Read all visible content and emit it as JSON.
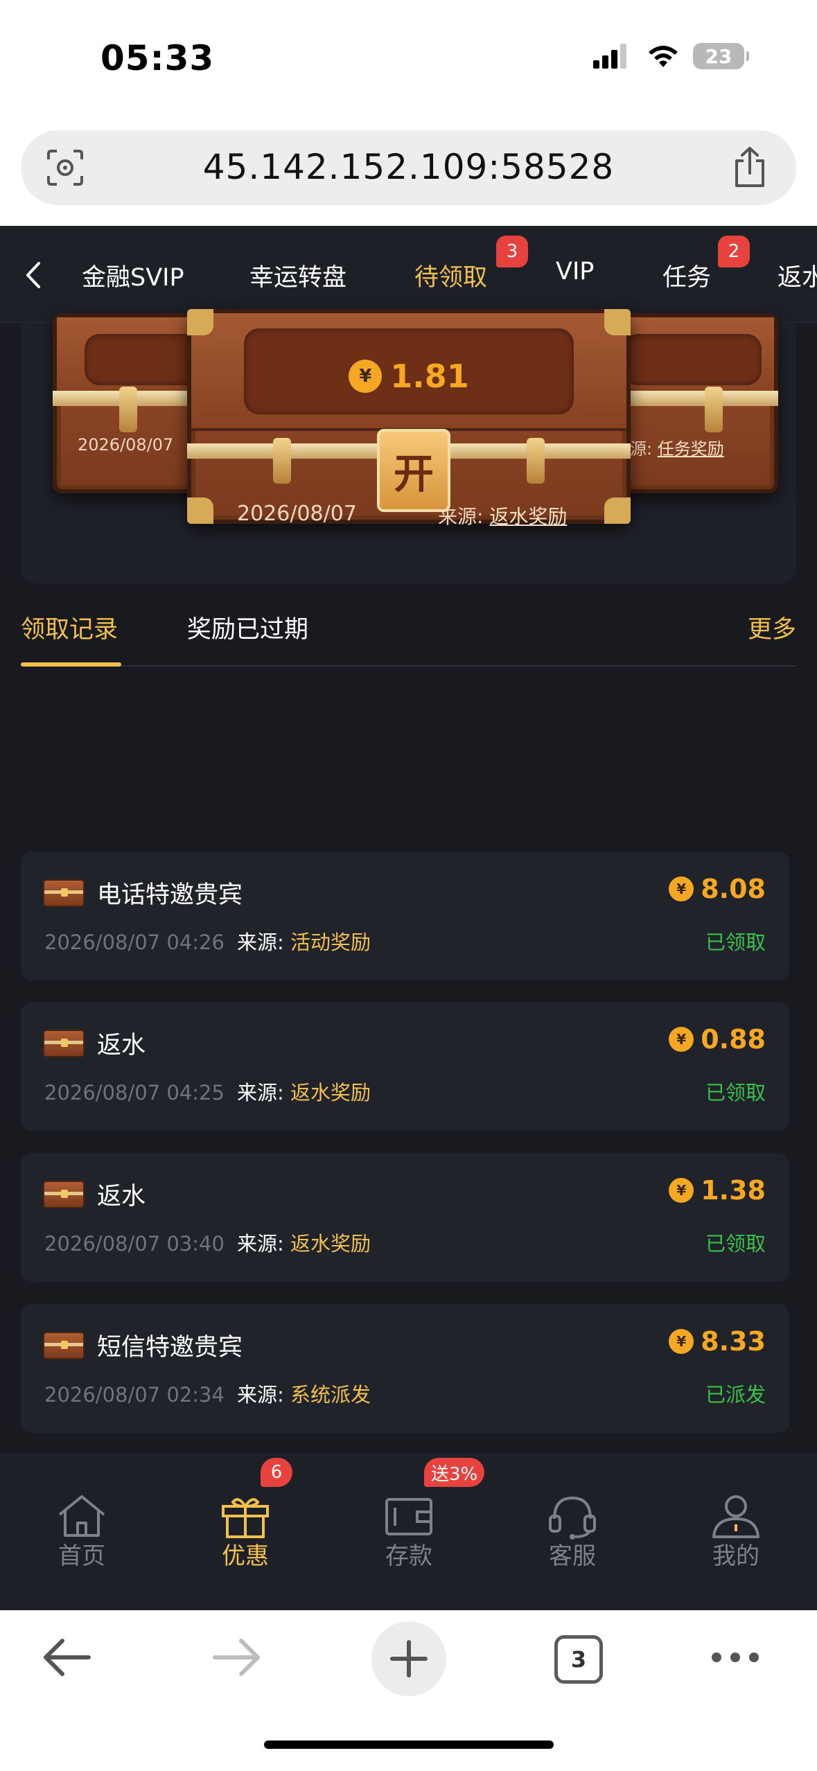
{
  "status_bar": {
    "time": "05:33",
    "battery": "23"
  },
  "browser": {
    "url": "45.142.152.109:58528",
    "tab_count": "3"
  },
  "top_tabs": [
    {
      "label": "金融SVIP"
    },
    {
      "label": "幸运转盘"
    },
    {
      "label": "待领取",
      "badge": "3",
      "active": true
    },
    {
      "label": "VIP"
    },
    {
      "label": "任务",
      "badge": "2"
    },
    {
      "label": "返水"
    }
  ],
  "chests": {
    "left": {
      "date": "2026/08/07"
    },
    "center": {
      "amount": "1.81",
      "lock_label": "开",
      "date": "2026/08/07",
      "source_label": "来源:",
      "source_value": "返水奖励"
    },
    "right": {
      "source_label": "源:",
      "source_value": "任务奖励"
    },
    "currency_symbol": "¥"
  },
  "records": {
    "tabs": [
      {
        "label": "领取记录",
        "active": true
      },
      {
        "label": "奖励已过期"
      }
    ],
    "more_label": "更多",
    "source_label": "来源:",
    "items": [
      {
        "title": "电话特邀贵宾",
        "datetime": "2026/08/07 04:26",
        "source": "活动奖励",
        "amount": "8.08",
        "status": "已领取"
      },
      {
        "title": "返水",
        "datetime": "2026/08/07 04:25",
        "source": "返水奖励",
        "amount": "0.88",
        "status": "已领取"
      },
      {
        "title": "返水",
        "datetime": "2026/08/07 03:40",
        "source": "返水奖励",
        "amount": "1.38",
        "status": "已领取"
      },
      {
        "title": "短信特邀贵宾",
        "datetime": "2026/08/07 02:34",
        "source": "系统派发",
        "amount": "8.33",
        "status": "已派发"
      }
    ]
  },
  "bottom_nav": [
    {
      "label": "首页",
      "icon": "home-icon"
    },
    {
      "label": "优惠",
      "icon": "gift-icon",
      "badge": "6",
      "active": true
    },
    {
      "label": "存款",
      "icon": "wallet-icon",
      "badge": "送3%"
    },
    {
      "label": "客服",
      "icon": "headset-icon"
    },
    {
      "label": "我的",
      "icon": "user-icon"
    }
  ],
  "colors": {
    "accent": "#f2c04c",
    "coin": "#f7a823",
    "success": "#36c24b",
    "badge": "#e8423f",
    "background": "#181a1f"
  }
}
